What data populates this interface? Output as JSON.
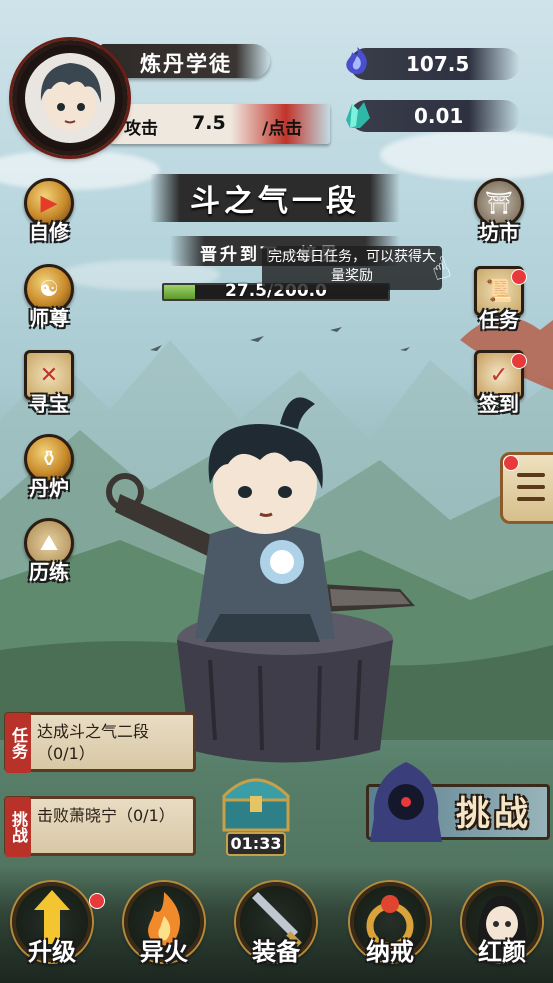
{
  "player": {
    "name": "炼丹学徒",
    "attack_label": "攻击",
    "attack_value": "7.5",
    "attack_unit": "/点击"
  },
  "resources": [
    {
      "icon": "spirit-flame-icon",
      "value": "107.5"
    },
    {
      "icon": "crystal-icon",
      "value": "0.01"
    }
  ],
  "realm": {
    "title": "斗之气一段",
    "upgrade_hint": "晋升到下一境界",
    "exp_text": "27.5/200.0",
    "exp_progress": 0.1375
  },
  "tooltip": {
    "text": "完成每日任务，可以获得大量奖励"
  },
  "left_menu": [
    {
      "label": "自修",
      "icon": "video-icon"
    },
    {
      "label": "师尊",
      "icon": "master-icon"
    },
    {
      "label": "寻宝",
      "icon": "treasure-map-icon"
    },
    {
      "label": "丹炉",
      "icon": "cauldron-icon"
    },
    {
      "label": "历练",
      "icon": "mountain-icon"
    }
  ],
  "right_menu": [
    {
      "label": "坊市",
      "icon": "market-icon",
      "badge": false
    },
    {
      "label": "任务",
      "icon": "scroll-icon",
      "badge": true
    },
    {
      "label": "签到",
      "icon": "checkin-icon",
      "badge": true
    }
  ],
  "quests": [
    {
      "tag": "任务",
      "text": "达成斗之气二段（0/1）"
    },
    {
      "tag": "挑战",
      "text": "击败萧晓宁（0/1）"
    }
  ],
  "chest": {
    "timer": "01:33"
  },
  "challenge": {
    "label": "挑战"
  },
  "bottom_nav": [
    {
      "label": "升级",
      "icon": "upgrade-arrow-icon",
      "badge": true
    },
    {
      "label": "异火",
      "icon": "fire-icon",
      "badge": false
    },
    {
      "label": "装备",
      "icon": "sword-icon",
      "badge": false
    },
    {
      "label": "纳戒",
      "icon": "ring-icon",
      "badge": false
    },
    {
      "label": "红颜",
      "icon": "maiden-icon",
      "badge": false
    }
  ],
  "colors": {
    "accent_red": "#c0342a",
    "exp_green": "#5c9a2c",
    "badge_red": "#e83a3a",
    "panel_parchment": "#e8dcc3"
  }
}
